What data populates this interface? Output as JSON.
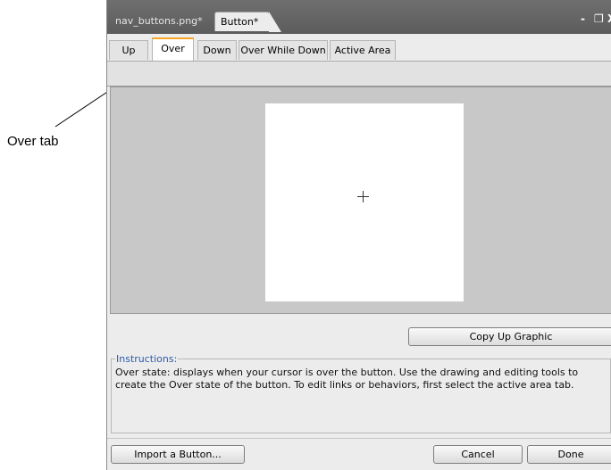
{
  "annotation": {
    "label": "Over tab"
  },
  "document_tabs": [
    {
      "label": "nav_buttons.png*"
    },
    {
      "label": "Button*"
    }
  ],
  "window_controls": {
    "minimize": "-",
    "restore": "҃",
    "close": "X"
  },
  "state_tabs": [
    {
      "label": "Up",
      "selected": false
    },
    {
      "label": "Over",
      "selected": true
    },
    {
      "label": "Down",
      "selected": false
    },
    {
      "label": "Over While Down",
      "selected": false
    },
    {
      "label": "Active Area",
      "selected": false
    }
  ],
  "buttons": {
    "copy_up_graphic": "Copy Up Graphic",
    "import_button": "Import a Button...",
    "cancel": "Cancel",
    "done": "Done"
  },
  "instructions": {
    "title": "Instructions:",
    "text": "Over state: displays when your cursor is over the button. Use the drawing and editing tools to create the Over state of the button. To edit links or behaviors, first select the active area tab."
  },
  "icons": {
    "canvas_cursor": "crosshair-icon"
  },
  "colors": {
    "selected_tab_accent": "#f5a623",
    "instructions_title": "#2a5db0"
  }
}
